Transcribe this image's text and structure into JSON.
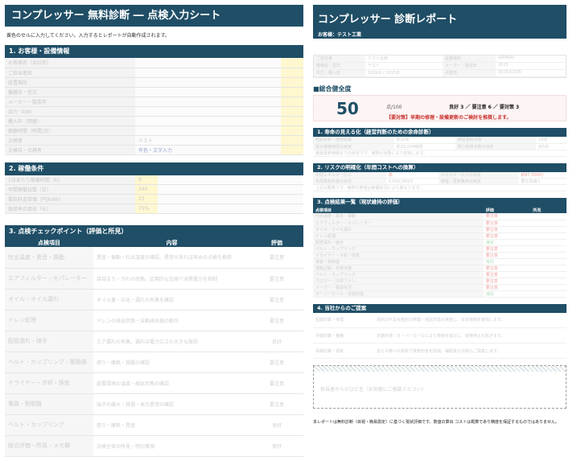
{
  "sheet": {
    "title": "コンプレッサー 無料診断 ― 点検入力シート",
    "note": "黄色のセルに入力してください。入力するとレポートが自動作成されます。",
    "section1": {
      "heading": "1. お客様・設備情報",
      "rows": [
        {
          "label": "お客様名（会社名）",
          "value": ""
        },
        {
          "label": "ご担当者名",
          "value": ""
        },
        {
          "label": "設置場所",
          "value": ""
        },
        {
          "label": "機種名・型式",
          "value": ""
        },
        {
          "label": "メーカー・製造年",
          "value": ""
        },
        {
          "label": "出力（kW）",
          "value": ""
        },
        {
          "label": "購入年（西暦）",
          "value": ""
        },
        {
          "label": "稼働時間（時間/日）",
          "value": ""
        },
        {
          "label": "点検者",
          "value": "テスト"
        },
        {
          "label": "点検日・点検者",
          "value": "有色・文字入力"
        }
      ]
    },
    "section2": {
      "heading": "2. 稼働条件",
      "rows": [
        {
          "label": "1日あたり稼働時間（h）",
          "value": "8"
        },
        {
          "label": "年間稼働日数（日）",
          "value": "240"
        },
        {
          "label": "電気料金単価（円/kWh）",
          "value": "25"
        },
        {
          "label": "負荷率の目安（%）",
          "value": "75%"
        }
      ]
    },
    "section3": {
      "heading": "3. 点検チェックポイント（評価と所見）",
      "columns": [
        "点検項目",
        "内容",
        "評価"
      ],
      "rows": [
        {
          "item": "吐出温度・異音・振動",
          "desc": "異音・振動・吐出温度の確認。異常があれば早めの点検を推奨",
          "rating": "要注意",
          "status": "warn"
        },
        {
          "item": "エアフィルター・セパレーター",
          "desc": "目詰まり・汚れの状態。定期的な交換で消費電力を抑制",
          "rating": "要注意",
          "status": "warn"
        },
        {
          "item": "オイル・オイル漏れ",
          "desc": "オイル量・劣化・漏れの有無を確認",
          "rating": "要注意",
          "status": "warn"
        },
        {
          "item": "ドレン処理",
          "desc": "ドレンの排出状態・自動排水器の動作",
          "rating": "要注意",
          "status": "warn"
        },
        {
          "item": "配管漏れ・継手",
          "desc": "エア漏れの有無。漏れは電力ロスの大きな原因",
          "rating": "良好",
          "status": "good"
        },
        {
          "item": "ベルト・カップリング・駆動部",
          "desc": "張り・摩耗・損傷の確認",
          "rating": "要注意",
          "status": "warn"
        },
        {
          "item": "ドライヤー・冷却・換気",
          "desc": "設置環境の温度・換気状態の確認",
          "rating": "要注意",
          "status": "warn"
        },
        {
          "item": "電装・制御盤",
          "desc": "端子の緩み・焼損・表示異常の確認",
          "rating": "要注意",
          "status": "warn"
        },
        {
          "item": "ベルト・カップリング",
          "desc": "張り・摩耗・異音",
          "rating": "良好",
          "status": "good"
        },
        {
          "item": "総合評価・所見・メモ欄",
          "desc": "点検全体の所見・特記事項",
          "rating": "良好",
          "status": "good"
        }
      ]
    }
  },
  "report": {
    "title": "コンプレッサー 診断レポート",
    "customer_label": "お客様：テスト工業",
    "info": [
      {
        "k": "ご担当者",
        "v": "テスト太郎"
      },
      {
        "k": "設置場所",
        "v": "AIRMAN"
      },
      {
        "k": "機種名・型式",
        "v": "テスト"
      },
      {
        "k": "メーカー・製造年",
        "v": "2015"
      },
      {
        "k": "出力・購入年",
        "v": "100kW / 2015年"
      },
      {
        "k": "点検日",
        "v": "2025/03/26"
      }
    ],
    "score_title": "■総合健全度",
    "score": "50",
    "score_max": "点/100",
    "counts": "良好 3 ／ 要注意 6 ／ 要対策 3",
    "score_message": "【要対策】早期の修理・設備更新のご検討を推奨します。",
    "sec1": {
      "heading": "1. 寿命の見える化（経営判断のための余命診断）",
      "rows": [
        {
          "a": "経過年数・使用年数",
          "b": "約10年",
          "c": "推奨更新年数",
          "d": "15年"
        },
        {
          "a": "累計稼働時間の目安",
          "b": "約19,200時間",
          "c": "残り耐用年数の目安",
          "d": "約5年"
        }
      ],
      "note": "推奨更新時期までの目安です。実際の状態により前後します。"
    },
    "sec2": {
      "heading": "2. リスクの明確化（年間コストへの換算）",
      "rows": [
        {
          "a": "年間エネルギーロス",
          "b": "高",
          "c": "エネルギーロスの目安",
          "d": "約87,300円"
        },
        {
          "a": "年間電気料金の目安",
          "b": "1,450,000円",
          "c": "修理・更新費用の目安",
          "d": "要お見積り"
        }
      ],
      "note": "上記は概算です。実際の数値は稼働状況により異なります。"
    },
    "sec3": {
      "heading": "3. 点検結果一覧（現状維持の評価）",
      "columns": [
        "点検項目",
        "評価",
        "所見"
      ],
      "rows": [
        {
          "a": "吐出温度・異音・振動",
          "b": "要注意",
          "s": "warn"
        },
        {
          "a": "エアフィルター・セパレーター",
          "b": "要注意",
          "s": "warn"
        },
        {
          "a": "オイル・オイル漏れ",
          "b": "要注意",
          "s": "warn"
        },
        {
          "a": "ドレン処理",
          "b": "要注意",
          "s": "warn"
        },
        {
          "a": "配管漏れ・継手",
          "b": "良好",
          "s": "good"
        },
        {
          "a": "ベルト・カップリング",
          "b": "要注意",
          "s": "warn"
        },
        {
          "a": "ドライヤー・冷却・換気",
          "b": "要注意",
          "s": "warn"
        },
        {
          "a": "電装・制御盤",
          "b": "良好",
          "s": "good"
        },
        {
          "a": "運転記録・日常点検",
          "b": "要注意",
          "s": "warn"
        },
        {
          "a": "ベルト・カップリング",
          "b": "要注意",
          "s": "warn"
        },
        {
          "a": "ブロワー・冷却ファン",
          "b": "要注意",
          "s": "warn"
        },
        {
          "a": "メーカー・製造状況",
          "b": "要注意",
          "s": "warn"
        },
        {
          "a": "オーバーホール・定期交換",
          "b": "良好",
          "s": "good"
        }
      ]
    },
    "sec4": {
      "heading": "4. 当社からのご提案",
      "rows": [
        {
          "tag": "短期対策・修理",
          "text": "現状の不具合箇所の修理・部品交換を実施し、安定稼働を確保します。",
          "c": "red"
        },
        {
          "tag": "中期対策・整備",
          "text": "定期点検・オーバーホールにより寿命を延ばし、突発停止を防ぎます。",
          "c": "org"
        },
        {
          "tag": "長期対策・更新",
          "text": "省エネ機への更新で電気料金を削減。補助金の活用もご提案します。",
          "c": "red"
        }
      ]
    },
    "memo": "担当者からのひと言（お気軽にご相談ください）",
    "footer": "本レポートは無料診断（目視・簡易測定）に基づく現状評価です。数値の算出 コストは概算であり精度を保証するものではありません。"
  }
}
